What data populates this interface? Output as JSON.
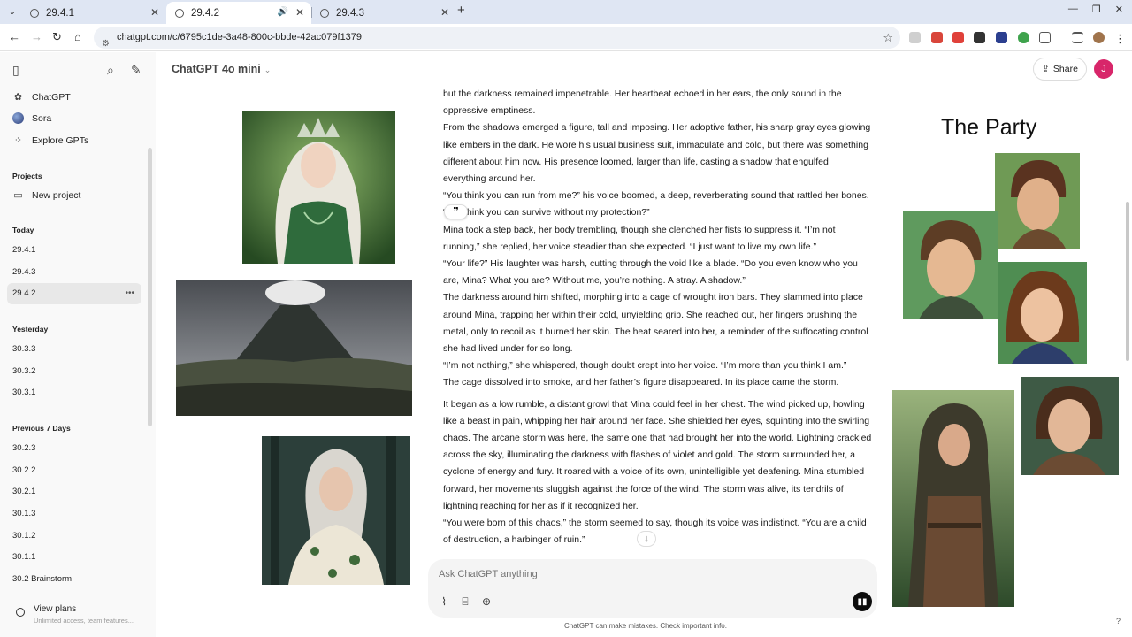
{
  "browser": {
    "tabs": [
      {
        "title": "29.4.1",
        "active": false
      },
      {
        "title": "29.4.2",
        "active": true
      },
      {
        "title": "29.4.3",
        "active": false
      }
    ],
    "url": "chatgpt.com/c/6795c1de-3a48-800c-bbde-42ac079f1379"
  },
  "sidebar": {
    "links": [
      {
        "label": "ChatGPT",
        "icon": "chatgpt-logo-icon"
      },
      {
        "label": "Sora",
        "icon": "sora-icon"
      },
      {
        "label": "Explore GPTs",
        "icon": "grid-icon"
      }
    ],
    "projects_heading": "Projects",
    "new_project": "New project",
    "today_heading": "Today",
    "today": [
      "29.4.1",
      "29.4.3",
      "29.4.2"
    ],
    "yesterday_heading": "Yesterday",
    "yesterday": [
      "30.3.3",
      "30.3.2",
      "30.3.1"
    ],
    "prev7_heading": "Previous 7 Days",
    "prev7": [
      "30.2.3",
      "30.2.2",
      "30.2.1",
      "30.1.3",
      "30.1.2",
      "30.1.1",
      "30.2 Brainstorm"
    ],
    "plans_title": "View plans",
    "plans_sub": "Unlimited access, team features..."
  },
  "header": {
    "model": "ChatGPT 4o mini",
    "share_label": "Share",
    "avatar_initial": "J"
  },
  "story": [
    "but the darkness remained impenetrable. Her heartbeat echoed in her ears, the only sound in the oppressive emptiness.",
    "From the shadows emerged a figure, tall and imposing. Her adoptive father, his sharp gray eyes glowing like embers in the dark. He wore his usual business suit, immaculate and cold, but there was something different about him now. His presence loomed, larger than life, casting a shadow that engulfed everything around her.",
    "“You think you can run from me?” his voice boomed, a deep, reverberating sound that rattled her bones. “You think you can survive without my protection?”",
    "Mina took a step back, her body trembling, though she clenched her fists to suppress it. “I’m not running,” she replied, her voice steadier than she expected. “I just want to live my own life.”",
    "“Your life?” His laughter was harsh, cutting through the void like a blade. “Do you even know who you are, Mina? What you are? Without me, you’re nothing. A stray. A shadow.”",
    "The darkness around him shifted, morphing into a cage of wrought iron bars. They slammed into place around Mina, trapping her within their cold, unyielding grip. She reached out, her fingers brushing the metal, only to recoil as it burned her skin. The heat seared into her, a reminder of the suffocating control she had lived under for so long.",
    "“I’m not nothing,” she whispered, though doubt crept into her voice. “I’m more than you think I am.”",
    "The cage dissolved into smoke, and her father’s figure disappeared. In its place came the storm.",
    "It began as a low rumble, a distant growl that Mina could feel in her chest. The wind picked up, howling like a beast in pain, whipping her hair around her face. She shielded her eyes, squinting into the swirling chaos. The arcane storm was here, the same one that had brought her into the world. Lightning crackled across the sky, illuminating the darkness with flashes of violet and gold. The storm surrounded her, a cyclone of energy and fury. It roared with a voice of its own, unintelligible yet deafening. Mina stumbled forward, her movements sluggish against the force of the wind. The storm was alive, its tendrils of lightning reaching for her as if it recognized her.",
    "“You were born of this chaos,” the storm seemed to say, though its voice was indistinct. “You are a child of destruction, a harbinger of ruin.”"
  ],
  "composer": {
    "placeholder": "Ask ChatGPT anything",
    "disclaimer": "ChatGPT can make mistakes. Check important info."
  },
  "party_title": "The Party"
}
